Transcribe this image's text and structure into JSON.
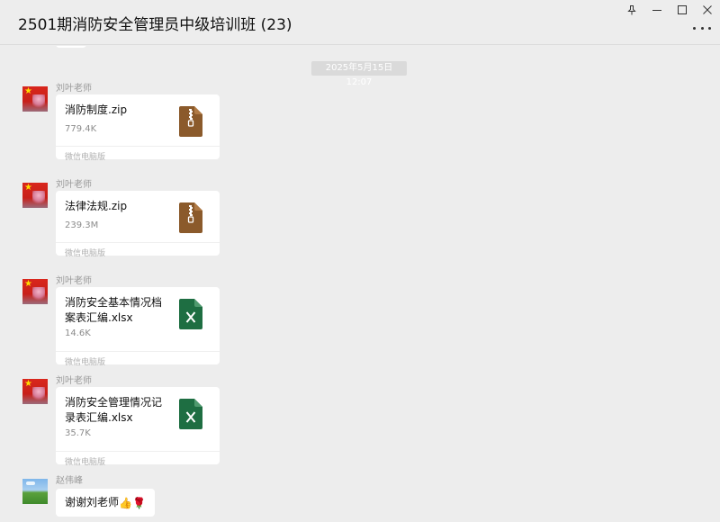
{
  "window": {
    "title": "2501期消防安全管理员中级培训班 (23)",
    "controls": {
      "pin_icon": "pin-icon",
      "minimize_icon": "minimize-icon",
      "maximize_icon": "maximize-icon",
      "close_icon": "close-icon"
    },
    "more_icon": "more-icon"
  },
  "chat": {
    "timestamp": "2025年5月15日 12:07",
    "messages": [
      {
        "sender": "刘叶老师",
        "avatar": "flag-avatar",
        "type": "file",
        "file_name": "消防制度.zip",
        "file_size": "779.4K",
        "file_type": "zip",
        "source": "微信电脑版"
      },
      {
        "sender": "刘叶老师",
        "avatar": "flag-avatar",
        "type": "file",
        "file_name": "法律法规.zip",
        "file_size": "239.3M",
        "file_type": "zip",
        "source": "微信电脑版"
      },
      {
        "sender": "刘叶老师",
        "avatar": "flag-avatar",
        "type": "file",
        "file_name": "消防安全基本情况档案表汇编.xlsx",
        "file_size": "14.6K",
        "file_type": "xlsx",
        "source": "微信电脑版"
      },
      {
        "sender": "刘叶老师",
        "avatar": "flag-avatar",
        "type": "file",
        "file_name": "消防安全管理情况记录表汇编.xlsx",
        "file_size": "35.7K",
        "file_type": "xlsx",
        "source": "微信电脑版"
      },
      {
        "sender": "赵伟峰",
        "avatar": "landscape-avatar",
        "type": "text",
        "text": "谢谢刘老师",
        "emojis": [
          "thumbs-up-emoji",
          "rose-emoji"
        ]
      }
    ]
  },
  "colors": {
    "background": "#ededed",
    "bubble": "#ffffff",
    "zip_icon": "#8b5a2b",
    "excel_icon": "#1e6e42",
    "muted_text": "#8c8c8c"
  }
}
